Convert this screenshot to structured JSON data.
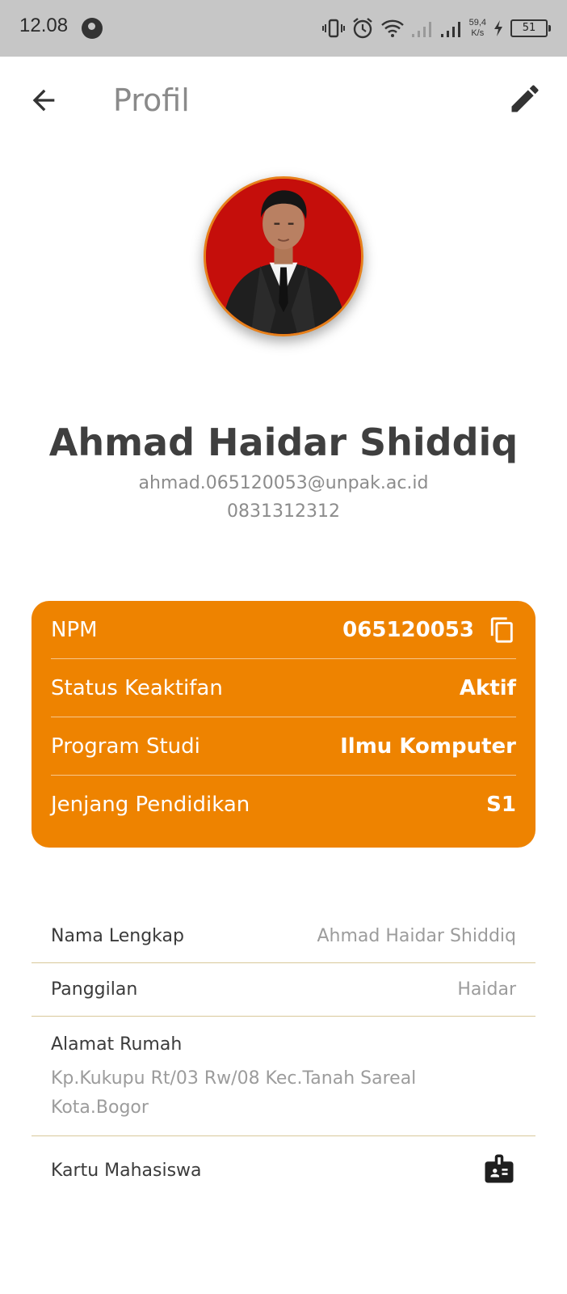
{
  "status_bar": {
    "time": "12.08",
    "net_speed_value": "59,4",
    "net_speed_unit": "K/s",
    "battery": "51"
  },
  "appbar": {
    "title": "Profil",
    "back_icon": "arrow-back-icon",
    "edit_icon": "pencil-icon"
  },
  "profile": {
    "name": "Ahmad Haidar Shiddiq",
    "email": "ahmad.065120053@unpak.ac.id",
    "phone": "0831312312"
  },
  "card": {
    "color": "#ee8300",
    "rows": [
      {
        "label": "NPM",
        "value": "065120053"
      },
      {
        "label": "Status Keaktifan",
        "value": "Aktif"
      },
      {
        "label": "Program Studi",
        "value": "Ilmu Komputer"
      },
      {
        "label": "Jenjang Pendidikan",
        "value": "S1"
      }
    ]
  },
  "details": {
    "full_name_label": "Nama Lengkap",
    "full_name_value": "Ahmad Haidar Shiddiq",
    "nickname_label": "Panggilan",
    "nickname_value": "Haidar",
    "address_label": "Alamat Rumah",
    "address_line1": "Kp.Kukupu Rt/03 Rw/08 Kec.Tanah Sareal",
    "address_line2": "Kota.Bogor",
    "student_card_label": "Kartu Mahasiswa",
    "student_card_icon": "id-badge-icon"
  }
}
